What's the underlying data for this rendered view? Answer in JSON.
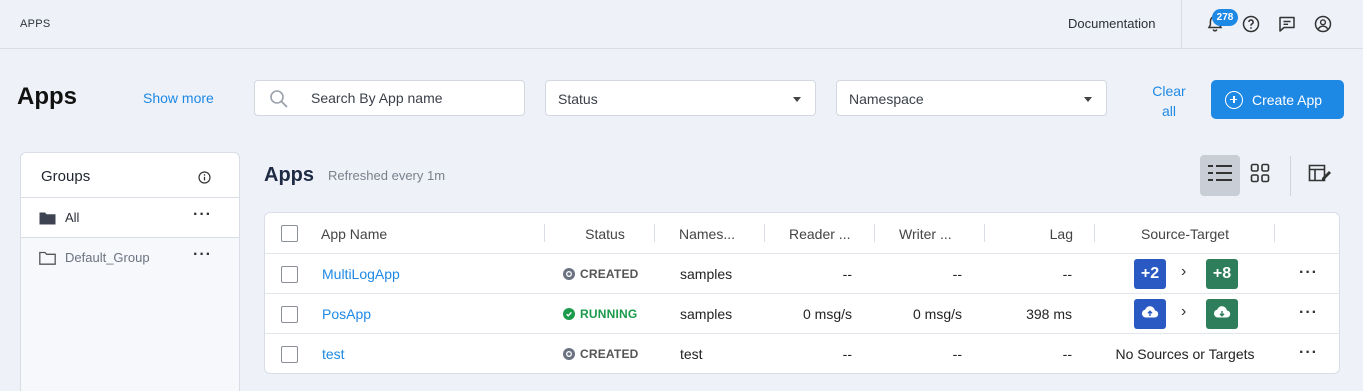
{
  "topbar": {
    "title": "APPS",
    "documentation": "Documentation",
    "notification_count": "278"
  },
  "header": {
    "title": "Apps",
    "show_more": "Show more",
    "search_placeholder": "Search By App name",
    "status_select": "Status",
    "namespace_select": "Namespace",
    "clear_all": "Clear all",
    "create_app": "Create App"
  },
  "groups": {
    "title": "Groups",
    "items": [
      {
        "label": "All",
        "active": true
      },
      {
        "label": "Default_Group",
        "active": false
      }
    ]
  },
  "list": {
    "title": "Apps",
    "refreshed": "Refreshed every 1m"
  },
  "table": {
    "columns": [
      "App Name",
      "Status",
      "Names...",
      "Reader ...",
      "Writer ...",
      "Lag",
      "Source-Target"
    ],
    "rows": [
      {
        "name": "MultiLogApp",
        "status": "CREATED",
        "namespace": "samples",
        "reader": "--",
        "writer": "--",
        "lag": "--",
        "sources": "+2",
        "targets": "+8"
      },
      {
        "name": "PosApp",
        "status": "RUNNING",
        "namespace": "samples",
        "reader": "0 msg/s",
        "writer": "0 msg/s",
        "lag": "398 ms",
        "source_icon": "cloud-upload-icon",
        "target_icon": "cloud-download-icon"
      },
      {
        "name": "test",
        "status": "CREATED",
        "namespace": "test",
        "reader": "--",
        "writer": "--",
        "lag": "--",
        "source_target_text": "No Sources or Targets"
      }
    ]
  },
  "colors": {
    "accent": "#1e88e5",
    "running": "#1b9a4b",
    "source": "#2b59c3",
    "target": "#2e7d5b"
  }
}
